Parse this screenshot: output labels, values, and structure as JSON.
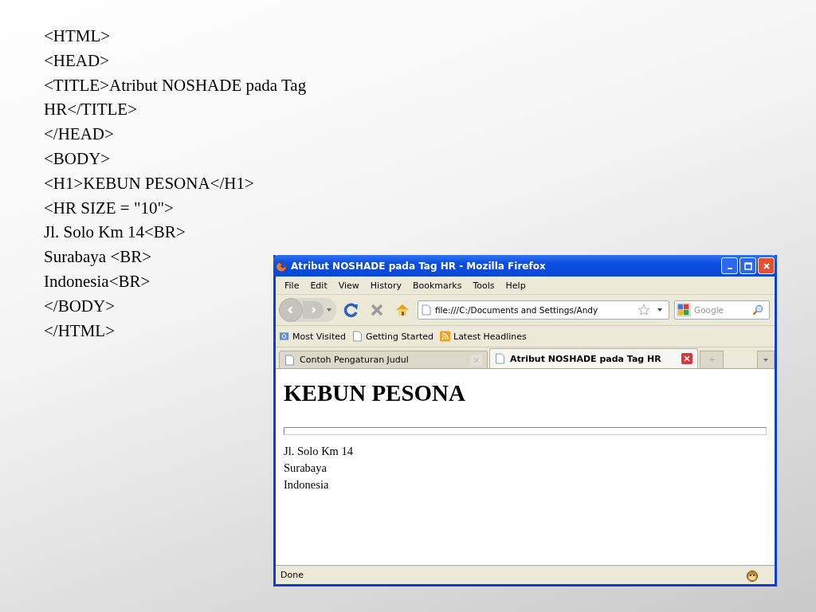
{
  "slide": {
    "code_lines": [
      "<HTML>",
      "<HEAD>",
      "<TITLE>Atribut NOSHADE pada Tag",
      "HR</TITLE>",
      "</HEAD>",
      "<BODY>",
      "<H1>KEBUN PESONA</H1>",
      "<HR SIZE = \"10\">",
      "Jl. Solo Km 14<BR>",
      "Surabaya <BR>",
      "Indonesia<BR>",
      "</BODY>",
      "</HTML>"
    ]
  },
  "browser": {
    "title": "Atribut NOSHADE pada Tag HR - Mozilla Firefox",
    "menu": [
      "File",
      "Edit",
      "View",
      "History",
      "Bookmarks",
      "Tools",
      "Help"
    ],
    "address": "file:///C:/Documents and Settings/Andy",
    "search": {
      "placeholder": "Google"
    },
    "bookmarks": [
      {
        "label": "Most Visited",
        "kind": "smart"
      },
      {
        "label": "Getting Started",
        "kind": "page"
      },
      {
        "label": "Latest Headlines",
        "kind": "feed"
      }
    ],
    "tabs": [
      {
        "label": "Contoh Pengaturan Judul",
        "selected": false
      },
      {
        "label": "Atribut NOSHADE pada Tag HR",
        "selected": true
      }
    ],
    "page": {
      "heading": "KEBUN PESONA",
      "lines": [
        "Jl. Solo Km 14",
        "Surabaya",
        "Indonesia"
      ]
    },
    "status": "Done"
  }
}
